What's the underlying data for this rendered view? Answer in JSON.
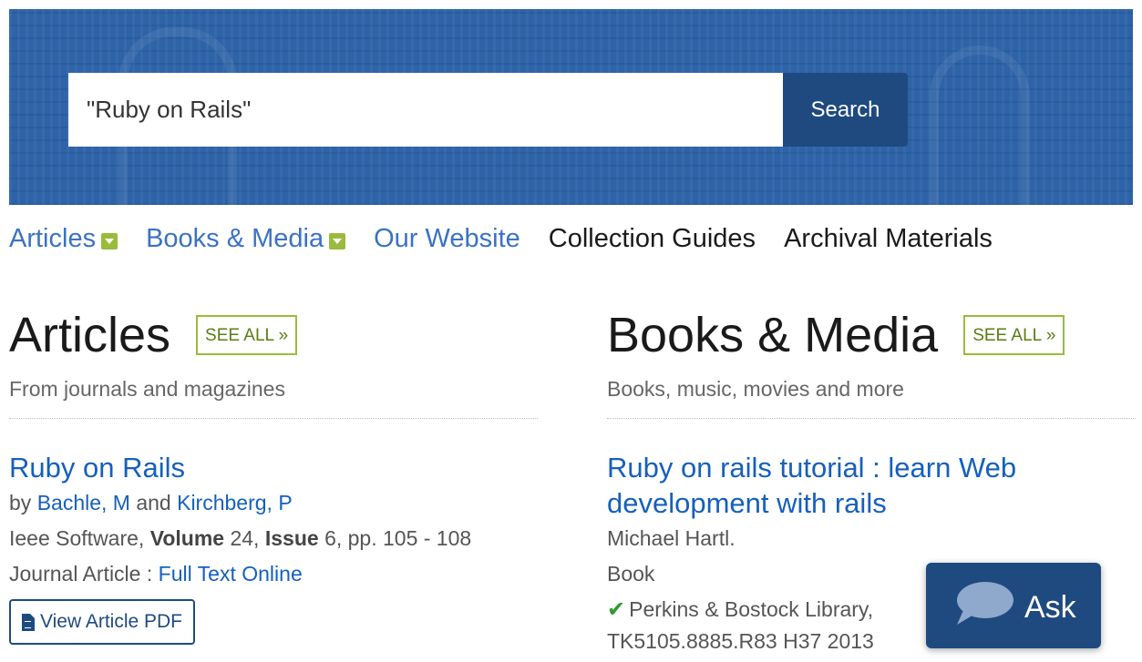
{
  "search": {
    "value": "\"Ruby on Rails\"",
    "button_label": "Search"
  },
  "nav": {
    "items": [
      {
        "label": "Articles",
        "dropdown": true
      },
      {
        "label": "Books & Media",
        "dropdown": true
      },
      {
        "label": "Our Website",
        "dropdown": false
      },
      {
        "label": "Collection Guides",
        "dropdown": false
      },
      {
        "label": "Archival Materials",
        "dropdown": false
      }
    ]
  },
  "articles": {
    "title": "Articles",
    "see_all": "SEE ALL »",
    "subtitle": "From journals and magazines",
    "result": {
      "title": "Ruby on Rails",
      "by": "by",
      "author1": "Bachle, M",
      "and": "and",
      "author2": "Kirchberg, P",
      "source": "Ieee Software,",
      "volume_label": "Volume",
      "volume": "24,",
      "issue_label": "Issue",
      "issue_pages": "6, pp. 105 - 108",
      "type_prefix": "Journal Article :",
      "full_text": "Full Text Online",
      "pdf_button": "View Article PDF"
    }
  },
  "books": {
    "title": "Books & Media",
    "see_all": "SEE ALL »",
    "subtitle": "Books, music, movies and more",
    "result": {
      "title": "Ruby on rails tutorial : learn Web development with rails",
      "author": "Michael Hartl.",
      "format": "Book",
      "location": "Perkins & Bostock Library,",
      "call_number": "TK5105.8885.R83 H37 2013"
    }
  },
  "chat": {
    "label": "Ask"
  },
  "colors": {
    "hero_blue": "#2b62a8",
    "button_dark_blue": "#1f4a80",
    "link_blue": "#1560bd",
    "accent_green": "#9bbb3c",
    "check_green": "#2e9a2e"
  }
}
